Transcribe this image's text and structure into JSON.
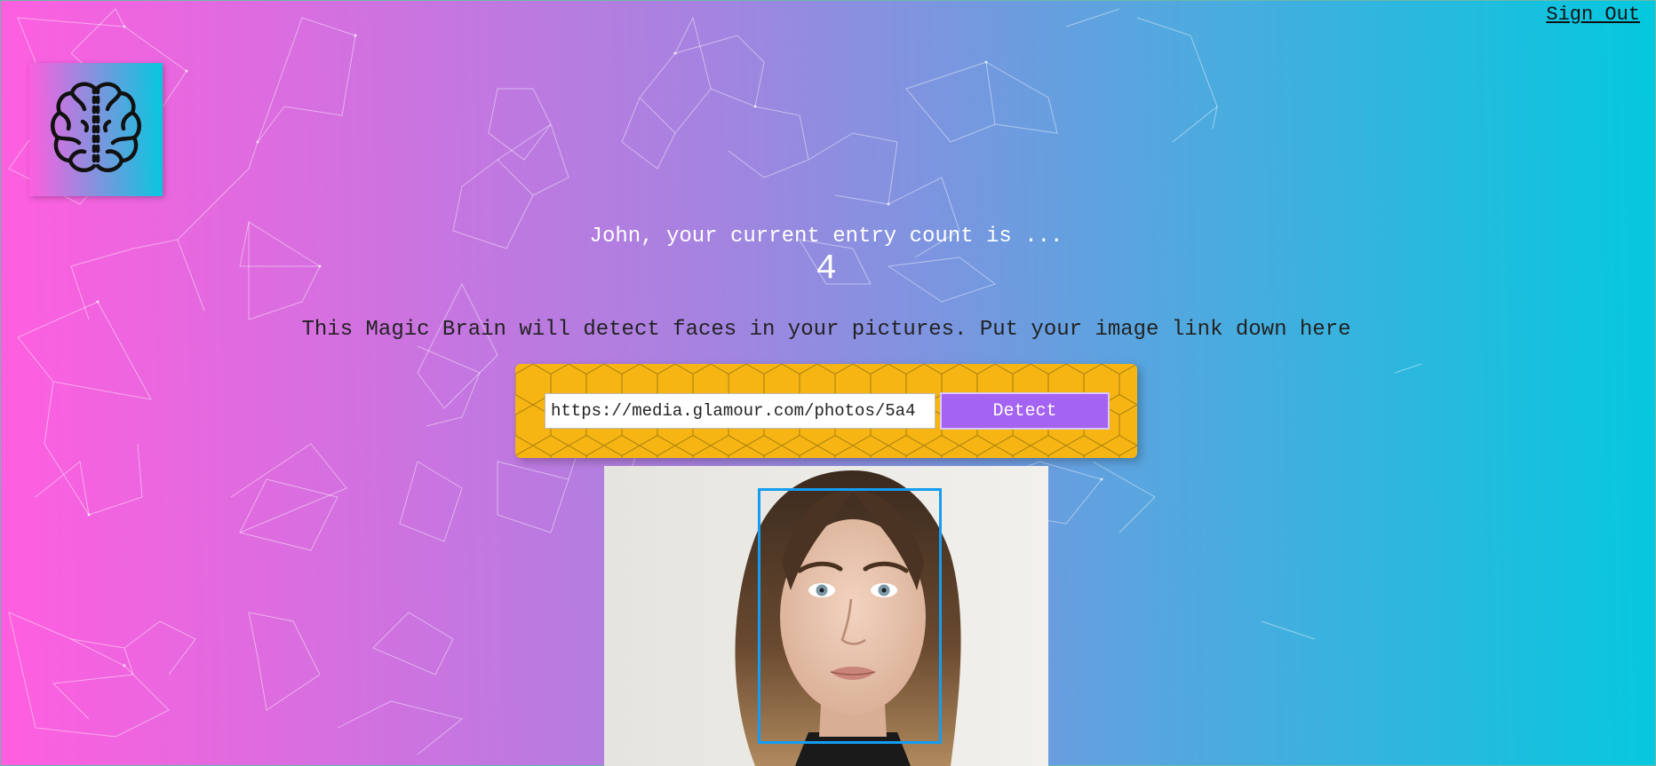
{
  "nav": {
    "sign_out": "Sign Out"
  },
  "logo": {
    "icon": "brain-icon"
  },
  "rank": {
    "greeting": "John, your current entry count is ...",
    "count": "4"
  },
  "intro": "This Magic Brain will detect faces in your pictures. Put your image link down here",
  "form": {
    "url_value": "https://media.glamour.com/photos/5a4",
    "button_label": "Detect"
  },
  "result": {
    "image": "woman-portrait",
    "face_box": "face-bounding-box"
  },
  "colors": {
    "gradient_left": "#ff5edf",
    "gradient_right": "#04c8de",
    "form_panel": "#f6b512",
    "button": "#a463f2",
    "face_box": "#149df2"
  }
}
